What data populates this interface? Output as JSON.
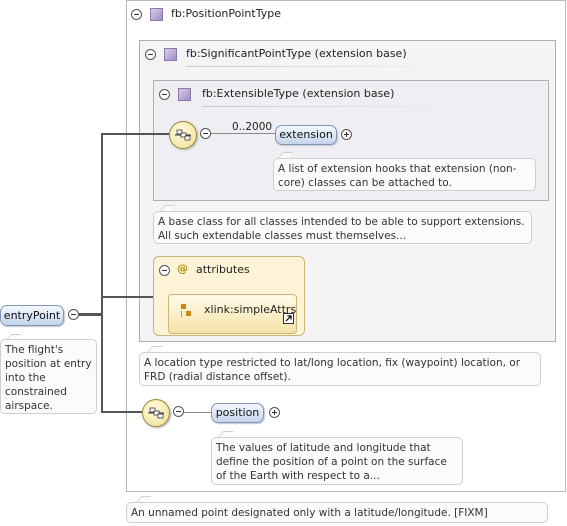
{
  "root": {
    "label": "entryPoint",
    "doc": "The flight's position at entry into the constrained airspace."
  },
  "position_point_type": {
    "title": "fb:PositionPointType",
    "doc": "A location type restricted to lat/long location, fix (waypoint) location, or FRD (radial distance offset)."
  },
  "significant_point_type": {
    "title": "fb:SignificantPointType (extension base)",
    "doc": "A base class for all classes intended to be able to support extensions. All such extendable classes must themselves..."
  },
  "extensible_type": {
    "title": "fb:ExtensibleType (extension base)",
    "cardinality": "0..2000",
    "element": "extension",
    "doc": "A list of extension hooks that extension (non-core) classes can be attached to."
  },
  "attributes": {
    "at_symbol": "@",
    "title": "attributes",
    "item": "xlink:simpleAttrs"
  },
  "position": {
    "element": "position",
    "doc": "The values of latitude and longitude that define the position of a point on the surface of the Earth with respect to a..."
  },
  "bottom_doc": "An unnamed point designated only with a latitude/longitude. [FIXM]",
  "colors": {
    "pill_border": "#7f96b8",
    "attr_fill": "#fdf4d8",
    "type_icon": "#a08cc4",
    "sequence_fill": "#f0df90"
  }
}
